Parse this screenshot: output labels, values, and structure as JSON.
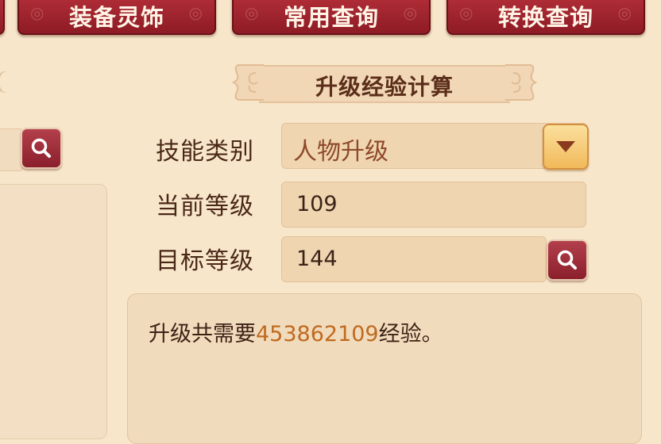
{
  "tabs": [
    {
      "label": "装备灵饰"
    },
    {
      "label": "常用查询"
    },
    {
      "label": "转换查询"
    }
  ],
  "panel_title": "升级经验计算",
  "form": {
    "skill_label": "技能类别",
    "skill_value": "人物升级",
    "current_label": "当前等级",
    "current_value": "109",
    "target_label": "目标等级",
    "target_value": "144"
  },
  "result": {
    "prefix": "升级共需要",
    "value": "453862109",
    "suffix": "经验。"
  },
  "colors": {
    "tab_red": "#9e2530",
    "page_bg": "#f7e6ca",
    "result_highlight": "#c06a1f",
    "dropdown_gold": "#f1b95a"
  },
  "icons": {
    "search": "search-icon",
    "dropdown": "triangle-down-icon"
  }
}
